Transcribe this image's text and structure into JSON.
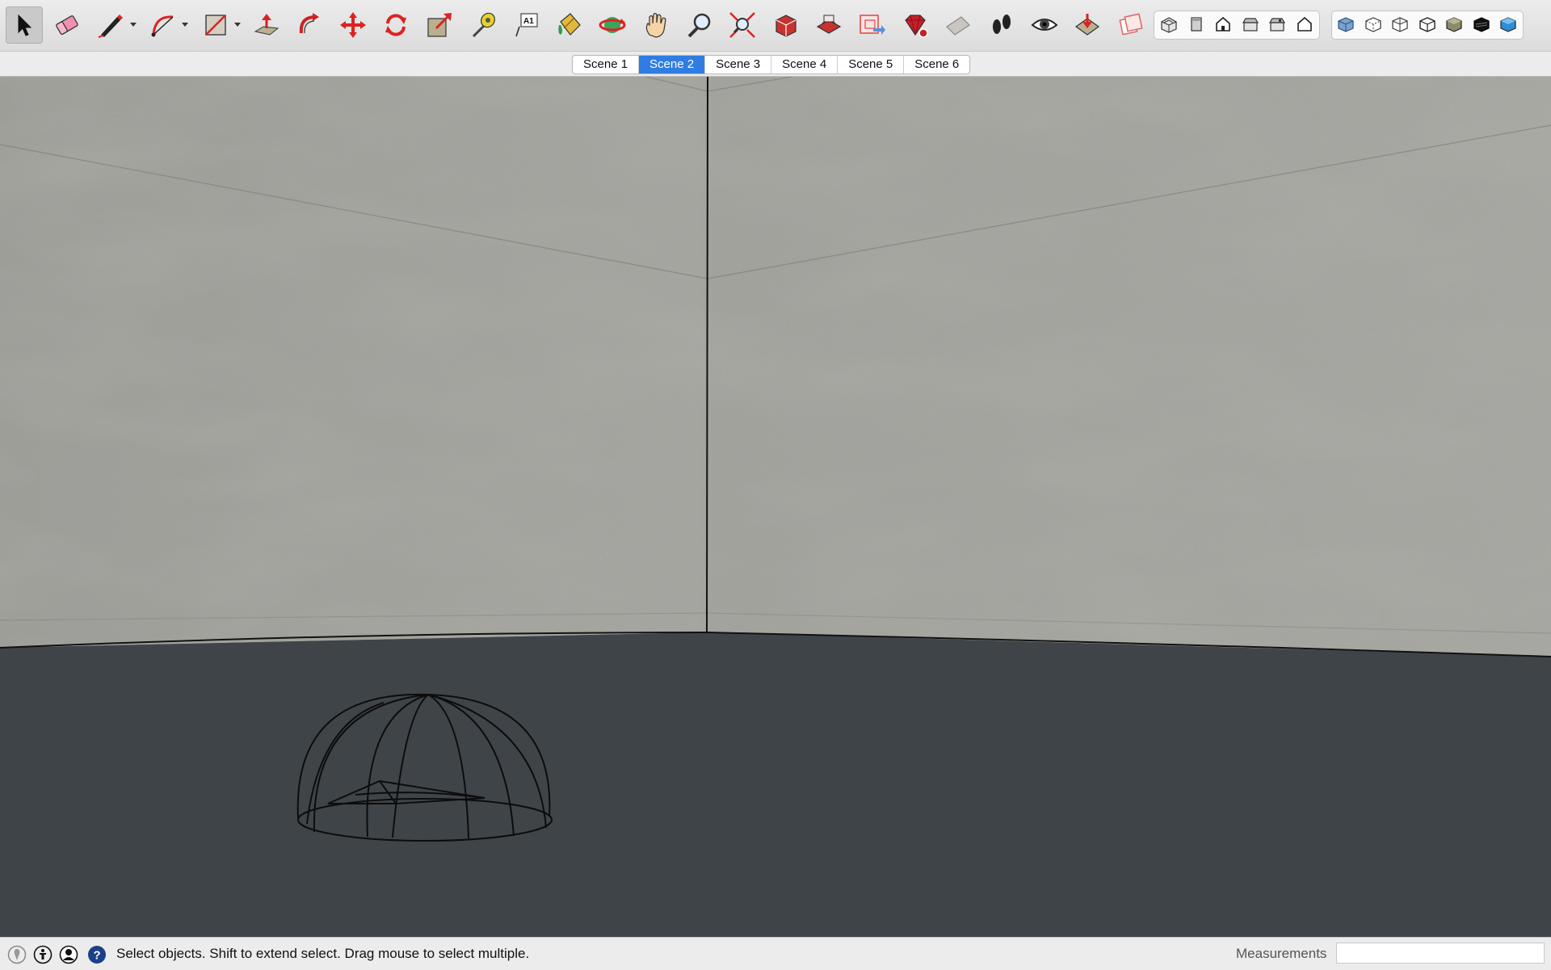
{
  "toolbar": {
    "tools": [
      {
        "name": "select-tool",
        "label": "Select"
      },
      {
        "name": "eraser-tool",
        "label": "Eraser"
      },
      {
        "name": "line-tool",
        "label": "Line"
      },
      {
        "name": "arc-tool",
        "label": "Arc"
      },
      {
        "name": "rectangle-tool",
        "label": "Rectangle"
      },
      {
        "name": "push-pull-tool",
        "label": "Push/Pull"
      },
      {
        "name": "follow-me-tool",
        "label": "Follow Me"
      },
      {
        "name": "move-tool",
        "label": "Move"
      },
      {
        "name": "rotate-tool",
        "label": "Rotate"
      },
      {
        "name": "scale-tool",
        "label": "Scale"
      },
      {
        "name": "tape-measure-tool",
        "label": "Tape Measure"
      },
      {
        "name": "text-tool",
        "label": "Text",
        "glyph": "A1"
      },
      {
        "name": "paint-bucket-tool",
        "label": "Paint Bucket"
      },
      {
        "name": "orbit-tool",
        "label": "Orbit"
      },
      {
        "name": "pan-tool",
        "label": "Pan"
      },
      {
        "name": "zoom-tool",
        "label": "Zoom"
      },
      {
        "name": "zoom-extents-tool",
        "label": "Zoom Extents"
      },
      {
        "name": "warehouse-tool",
        "label": "3D Warehouse"
      },
      {
        "name": "share-model-tool",
        "label": "Share Model"
      },
      {
        "name": "layout-tool",
        "label": "Send to LayOut"
      },
      {
        "name": "extension-warehouse-tool",
        "label": "Extension Warehouse"
      },
      {
        "name": "section-plane-tool",
        "label": "Section Plane"
      },
      {
        "name": "walk-tool",
        "label": "Walk"
      },
      {
        "name": "look-around-tool",
        "label": "Look Around"
      },
      {
        "name": "position-camera-tool",
        "label": "Position Camera"
      },
      {
        "name": "extension-manager-tool",
        "label": "Extension Manager"
      }
    ],
    "views": [
      "iso",
      "top",
      "front",
      "right",
      "back",
      "left"
    ],
    "styles": [
      "xray",
      "back-edges",
      "wireframe",
      "hidden-line",
      "shaded",
      "shaded-textures",
      "monochrome"
    ]
  },
  "scenes": {
    "tabs": [
      "Scene 1",
      "Scene 2",
      "Scene 3",
      "Scene 4",
      "Scene 5",
      "Scene 6"
    ],
    "selected": "Scene 2"
  },
  "viewport": {
    "wall_color": "#a3a49e",
    "floor_color": "#3f4449",
    "edge_color": "#111111"
  },
  "status": {
    "message": "Select objects. Shift to extend select. Drag mouse to select multiple.",
    "measurements_label": "Measurements",
    "measurements_value": ""
  }
}
